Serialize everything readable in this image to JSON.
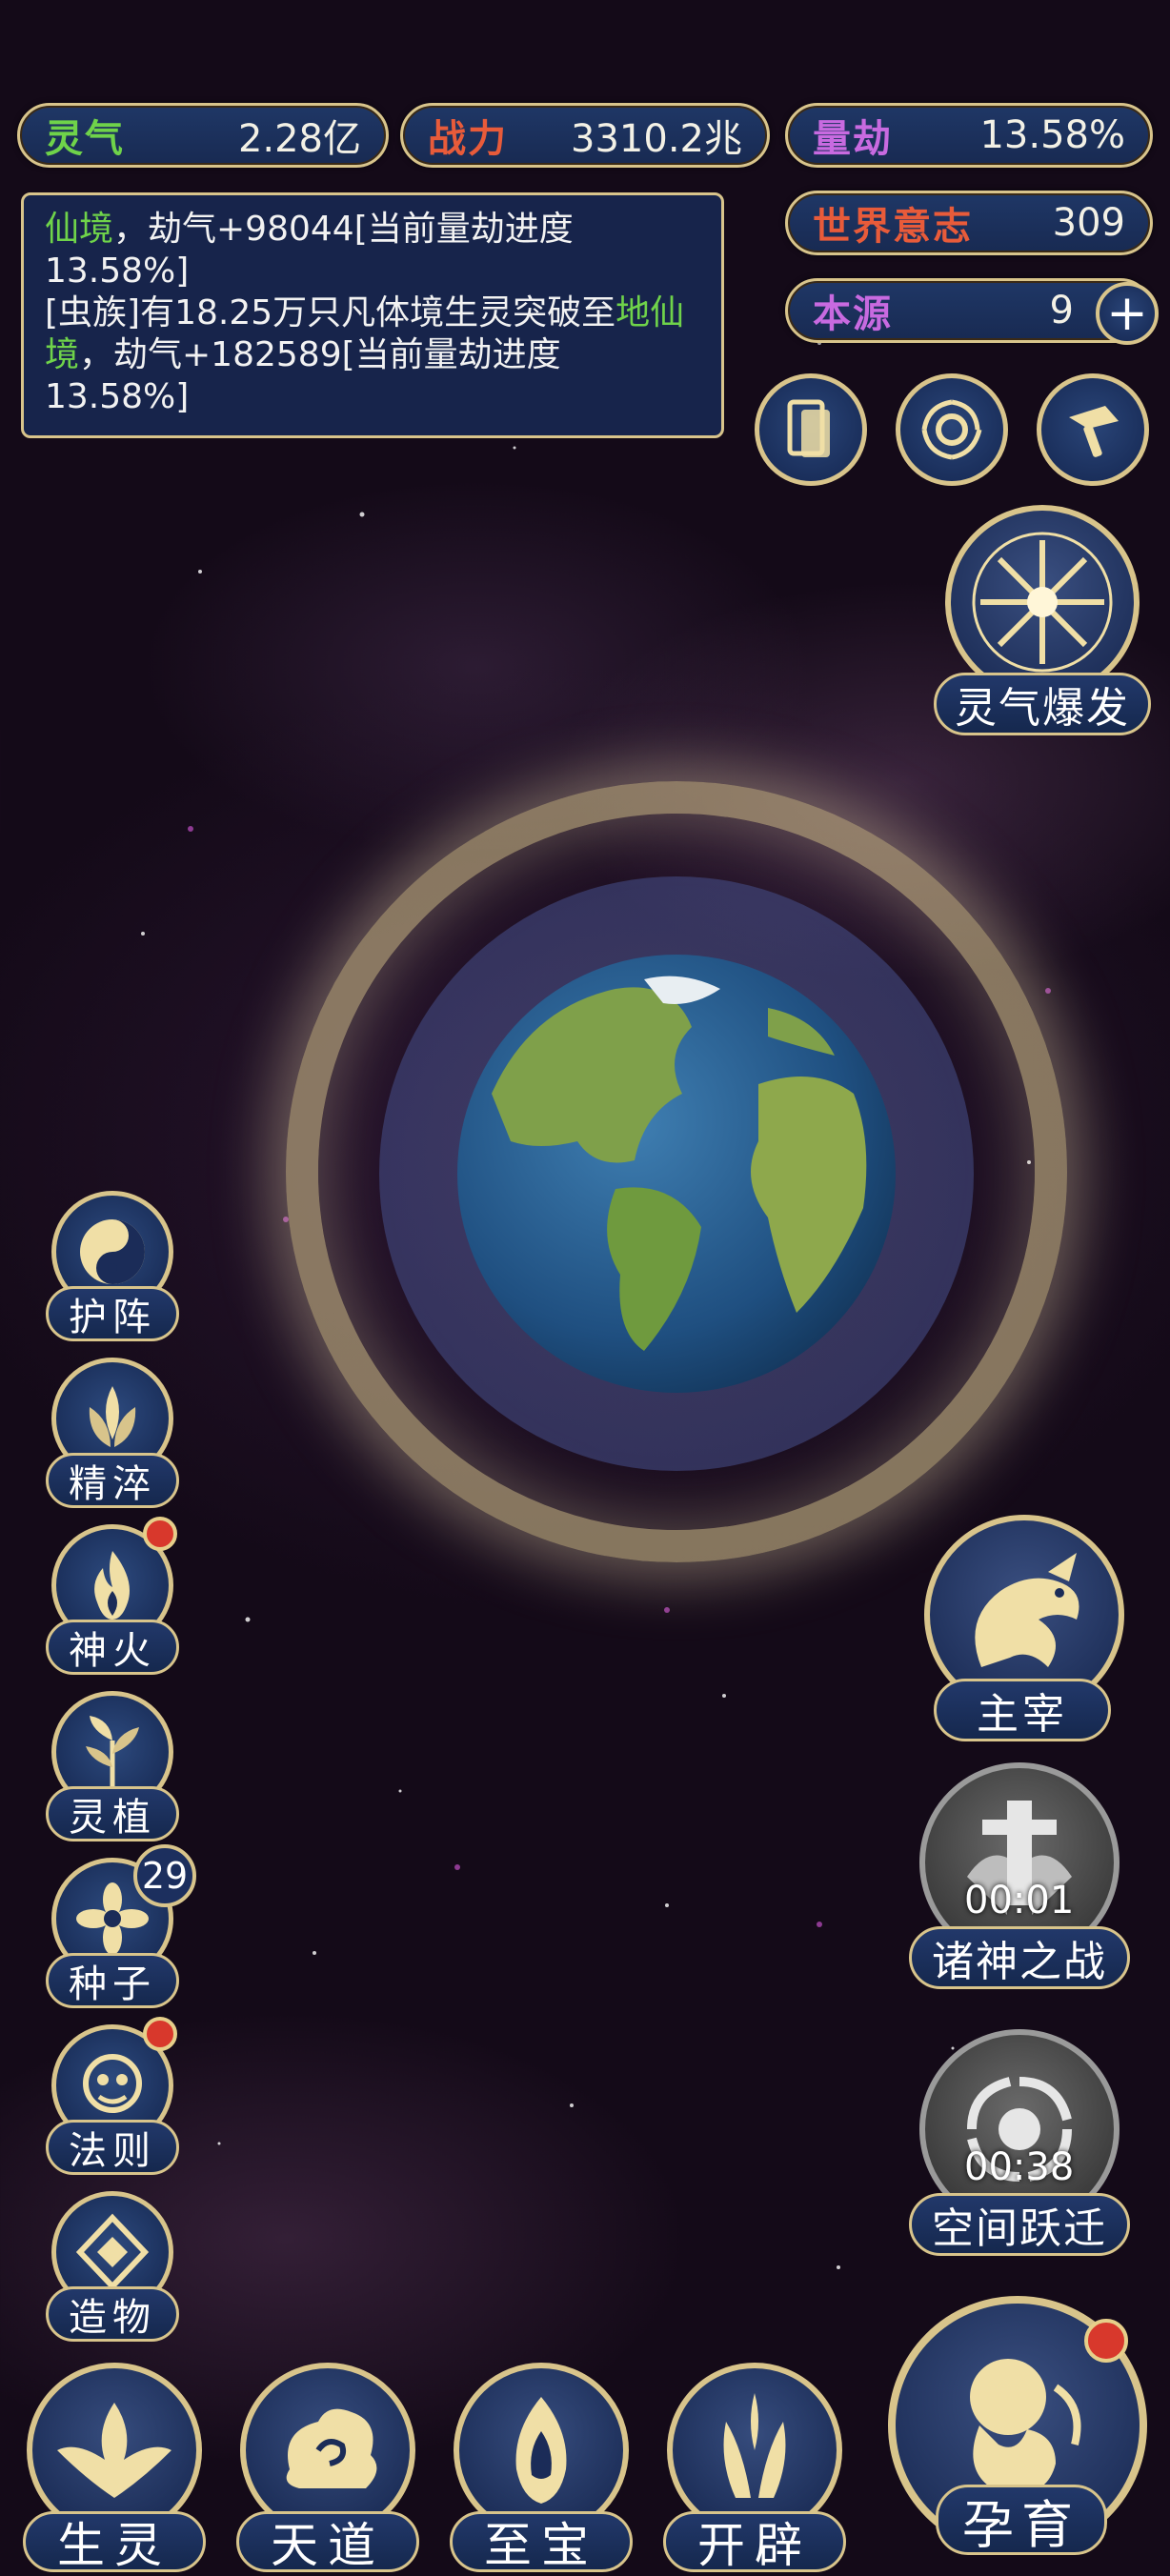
{
  "stats": {
    "lingqi": {
      "label": "灵气",
      "value": "2.28亿",
      "color": "#6fd34a"
    },
    "zhanli": {
      "label": "战力",
      "value": "3310.2兆",
      "color": "#e85b3a"
    },
    "liangjie": {
      "label": "量劫",
      "value": "13.58%",
      "color": "#c86ae0"
    },
    "shijie": {
      "label": "世界意志",
      "value": "309",
      "color": "#e85b3a"
    },
    "benyuan": {
      "label": "本源",
      "value": "9",
      "color": "#c86ae0"
    }
  },
  "messages": {
    "line1_green": "仙境",
    "line1_rest": "，劫气+98044[当前量劫进度13.58%]",
    "line2_a": "[虫族]有18.25万只凡体境生灵突破至",
    "line2_green": "地仙境",
    "line2_rest": "，劫气+182589[当前量劫进度13.58%]"
  },
  "top_icons": [
    "cards-icon",
    "swirl-icon",
    "hammer-icon"
  ],
  "burst": {
    "label": "灵气爆发"
  },
  "side_menu": [
    {
      "label": "护阵",
      "icon": "yin-yang-icon",
      "badge": ""
    },
    {
      "label": "精淬",
      "icon": "lotus-flame-icon",
      "badge": ""
    },
    {
      "label": "神火",
      "icon": "fire-icon",
      "badge": "dot"
    },
    {
      "label": "灵植",
      "icon": "plant-icon",
      "badge": ""
    },
    {
      "label": "种子",
      "icon": "seed-flower-icon",
      "badge": "29"
    },
    {
      "label": "法则",
      "icon": "rune-beast-icon",
      "badge": "dot"
    },
    {
      "label": "造物",
      "icon": "diamond-icon",
      "badge": ""
    }
  ],
  "right_menu": {
    "zhuzai": {
      "label": "主宰",
      "icon": "dragon-icon"
    },
    "zhushen": {
      "label": "诸神之战",
      "timer": "00:01",
      "icon": "sword-icon"
    },
    "kongjian": {
      "label": "空间跃迁",
      "timer": "00:38",
      "icon": "vortex-icon"
    }
  },
  "bottom_nav": [
    {
      "label": "生灵",
      "icon": "phoenix-icon"
    },
    {
      "label": "天道",
      "icon": "cloud-swirl-icon"
    },
    {
      "label": "至宝",
      "icon": "treasure-icon"
    },
    {
      "label": "开辟",
      "icon": "axe-flame-icon"
    }
  ],
  "yunyu": {
    "label": "孕育",
    "icon": "fetus-icon"
  }
}
